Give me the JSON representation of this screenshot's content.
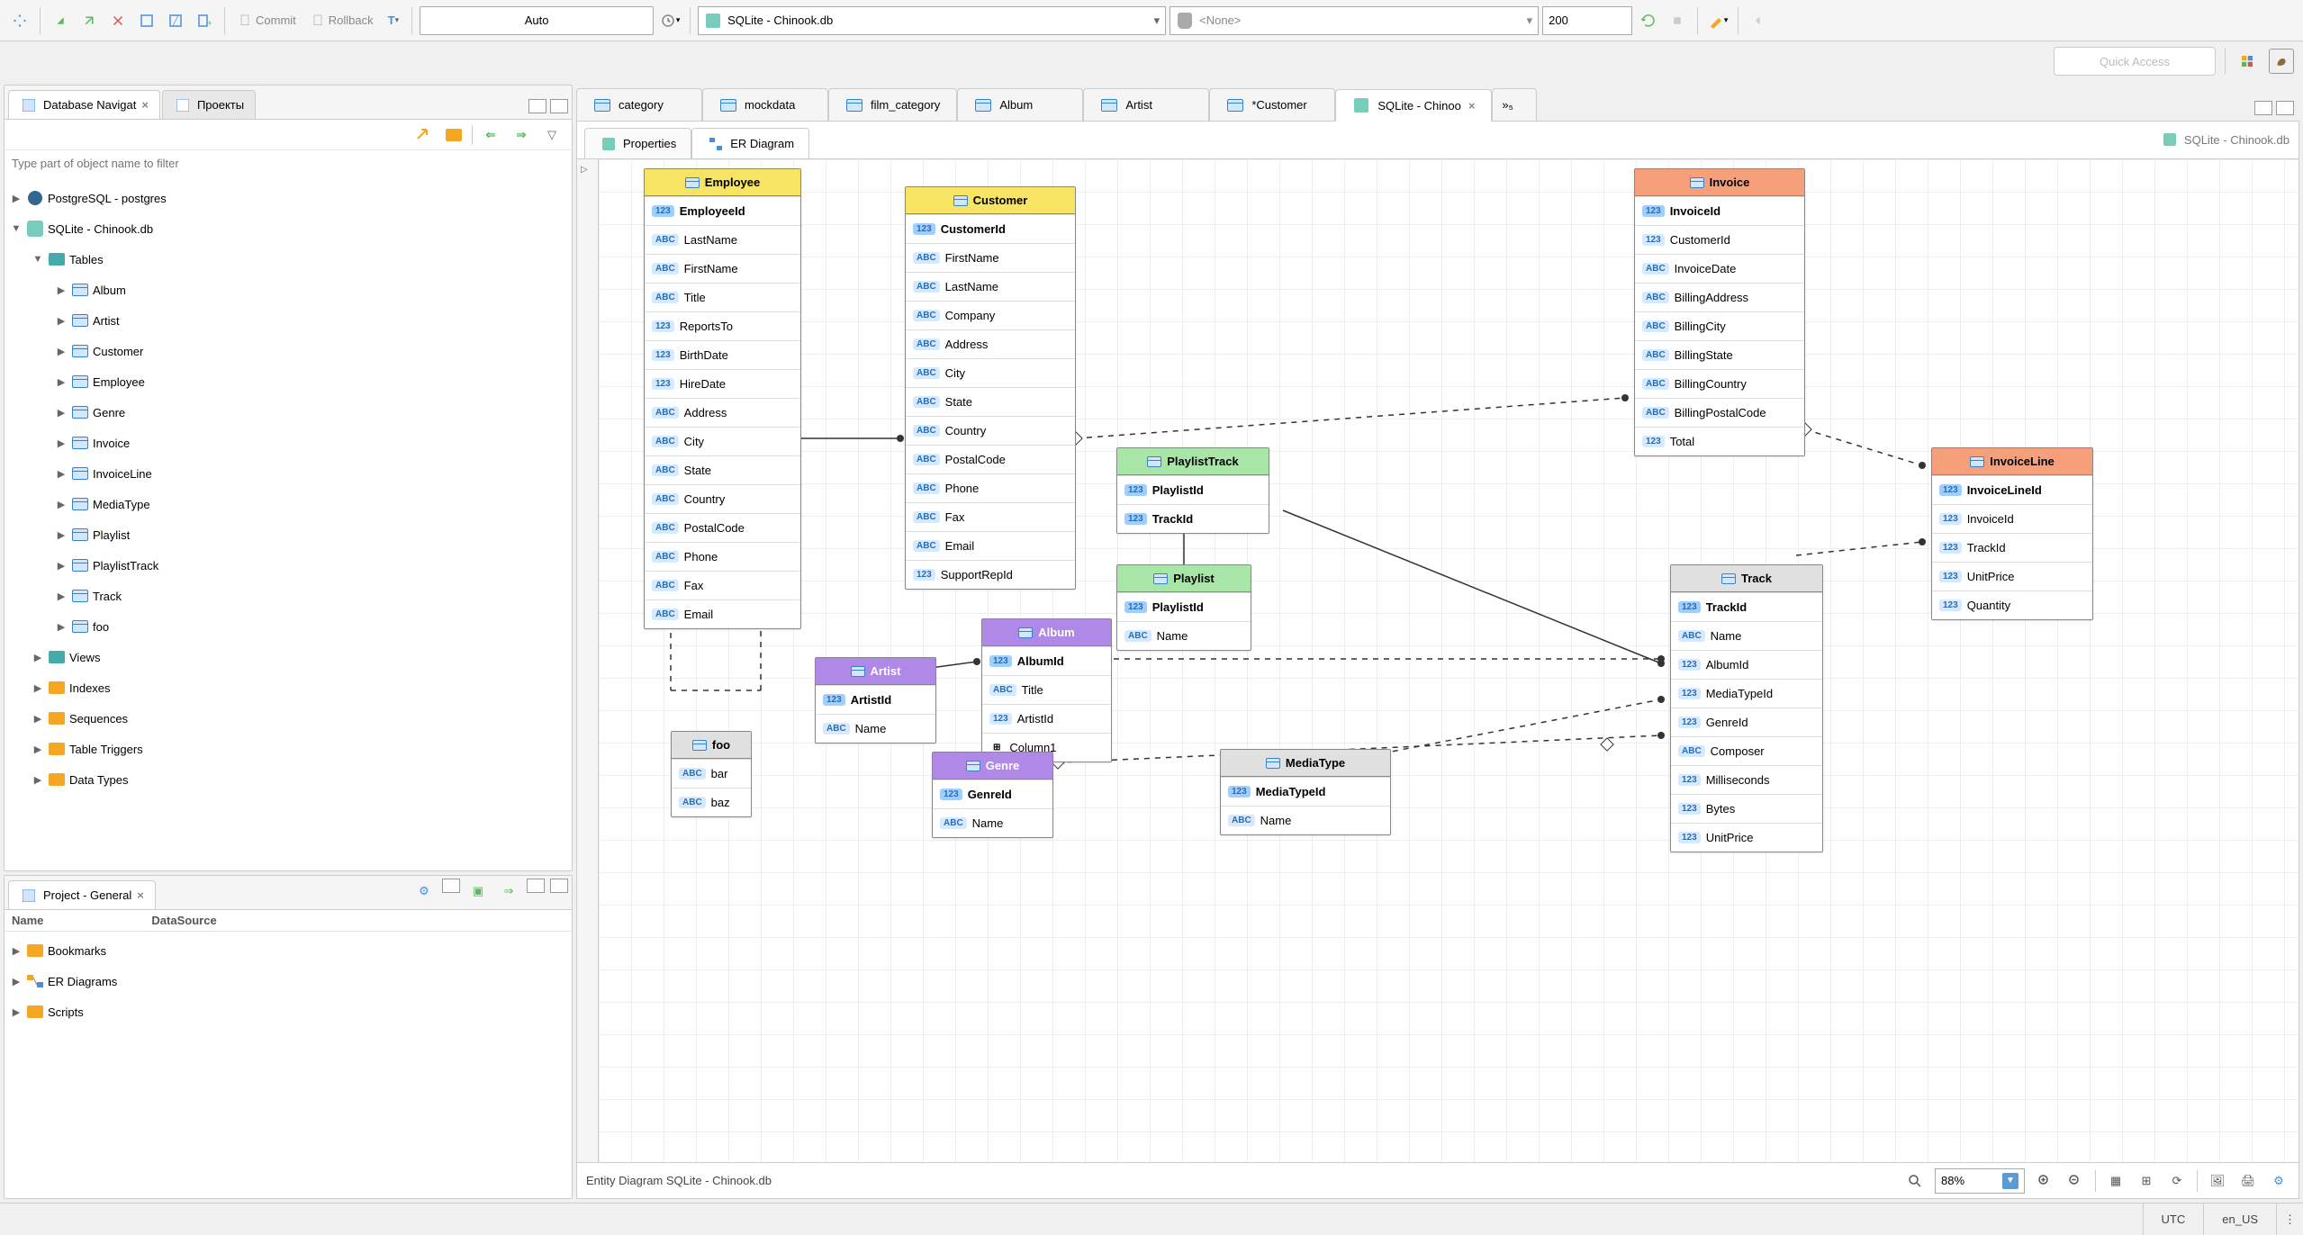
{
  "toolbar": {
    "commit": "Commit",
    "rollback": "Rollback",
    "tx": "T",
    "auto": "Auto",
    "db": "SQLite - Chinook.db",
    "schema": "<None>",
    "rows": "200"
  },
  "quick_access": "Quick Access",
  "nav": {
    "tab1": "Database Navigat",
    "tab2": "Проекты",
    "filter_placeholder": "Type part of object name to filter",
    "tree": {
      "pg": "PostgreSQL - postgres",
      "sqlite": "SQLite - Chinook.db",
      "tables_lbl": "Tables",
      "tables": [
        "Album",
        "Artist",
        "Customer",
        "Employee",
        "Genre",
        "Invoice",
        "InvoiceLine",
        "MediaType",
        "Playlist",
        "PlaylistTrack",
        "Track",
        "foo"
      ],
      "views": "Views",
      "indexes": "Indexes",
      "sequences": "Sequences",
      "triggers": "Table Triggers",
      "datatypes": "Data Types"
    }
  },
  "project": {
    "title": "Project - General",
    "col_name": "Name",
    "col_ds": "DataSource",
    "items": {
      "bookmarks": "Bookmarks",
      "er": "ER Diagrams",
      "scripts": "Scripts"
    }
  },
  "editor_tabs": {
    "category": "category",
    "mockdata": "mockdata",
    "film_category": "film_category",
    "album": "Album",
    "artist": "Artist",
    "customer": "*Customer",
    "sqlite": "SQLite - Chinoo",
    "overflow": "»₅"
  },
  "sub_tabs": {
    "properties": "Properties",
    "er": "ER Diagram"
  },
  "crumb": "SQLite - Chinook.db",
  "entities": {
    "employee": {
      "name": "Employee",
      "pk": "EmployeeId",
      "cols": [
        "LastName",
        "FirstName",
        "Title",
        "ReportsTo",
        "BirthDate",
        "HireDate",
        "Address",
        "City",
        "State",
        "Country",
        "PostalCode",
        "Phone",
        "Fax",
        "Email"
      ],
      "types": [
        "txt",
        "txt",
        "txt",
        "num",
        "num",
        "num",
        "txt",
        "txt",
        "txt",
        "txt",
        "txt",
        "txt",
        "txt",
        "txt"
      ]
    },
    "customer": {
      "name": "Customer",
      "pk": "CustomerId",
      "cols": [
        "FirstName",
        "LastName",
        "Company",
        "Address",
        "City",
        "State",
        "Country",
        "PostalCode",
        "Phone",
        "Fax",
        "Email",
        "SupportRepId"
      ],
      "types": [
        "txt",
        "txt",
        "txt",
        "txt",
        "txt",
        "txt",
        "txt",
        "txt",
        "txt",
        "txt",
        "txt",
        "num"
      ]
    },
    "invoice": {
      "name": "Invoice",
      "pk": "InvoiceId",
      "cols": [
        "CustomerId",
        "InvoiceDate",
        "BillingAddress",
        "BillingCity",
        "BillingState",
        "BillingCountry",
        "BillingPostalCode",
        "Total"
      ],
      "types": [
        "num",
        "txt",
        "txt",
        "txt",
        "txt",
        "txt",
        "txt",
        "num"
      ]
    },
    "invoiceline": {
      "name": "InvoiceLine",
      "pk": "InvoiceLineId",
      "cols": [
        "InvoiceId",
        "TrackId",
        "UnitPrice",
        "Quantity"
      ],
      "types": [
        "num",
        "num",
        "num",
        "num"
      ]
    },
    "playlisttrack": {
      "name": "PlaylistTrack",
      "pk": "PlaylistId",
      "pk2": "TrackId"
    },
    "playlist": {
      "name": "Playlist",
      "pk": "PlaylistId",
      "cols": [
        "Name"
      ],
      "types": [
        "txt"
      ]
    },
    "track": {
      "name": "Track",
      "pk": "TrackId",
      "cols": [
        "Name",
        "AlbumId",
        "MediaTypeId",
        "GenreId",
        "Composer",
        "Milliseconds",
        "Bytes",
        "UnitPrice"
      ],
      "types": [
        "txt",
        "num",
        "num",
        "num",
        "txt",
        "num",
        "num",
        "num"
      ]
    },
    "album": {
      "name": "Album",
      "pk": "AlbumId",
      "cols": [
        "Title",
        "ArtistId",
        "Column1"
      ],
      "types": [
        "txt",
        "num",
        "spc"
      ]
    },
    "artist": {
      "name": "Artist",
      "pk": "ArtistId",
      "cols": [
        "Name"
      ],
      "types": [
        "txt"
      ]
    },
    "genre": {
      "name": "Genre",
      "pk": "GenreId",
      "cols": [
        "Name"
      ],
      "types": [
        "txt"
      ]
    },
    "mediatype": {
      "name": "MediaType",
      "pk": "MediaTypeId",
      "cols": [
        "Name"
      ],
      "types": [
        "txt"
      ]
    },
    "foo": {
      "name": "foo",
      "cols": [
        "bar",
        "baz"
      ],
      "types": [
        "txt",
        "txt"
      ]
    }
  },
  "status_editor": {
    "label": "Entity Diagram SQLite - Chinook.db",
    "zoom": "88%"
  },
  "statusbar": {
    "tz": "UTC",
    "locale": "en_US"
  }
}
